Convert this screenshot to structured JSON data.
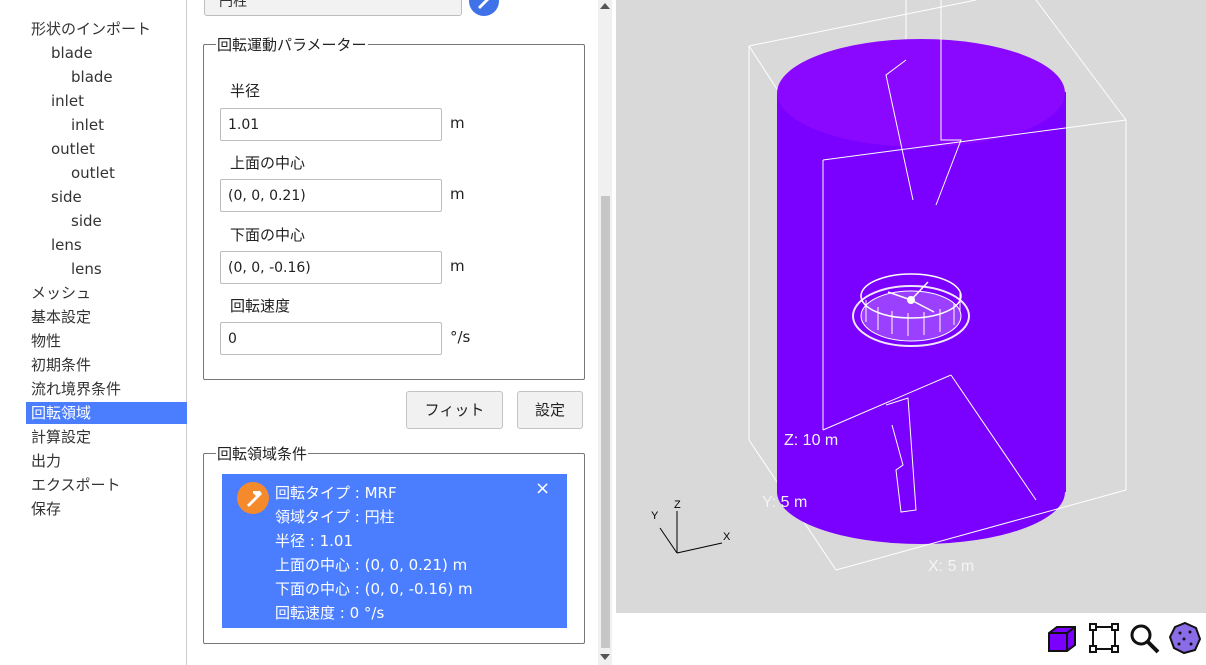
{
  "tree": [
    {
      "label": "形状のインポート",
      "level": 0
    },
    {
      "label": "blade",
      "level": 1
    },
    {
      "label": "blade",
      "level": 2
    },
    {
      "label": "inlet",
      "level": 1
    },
    {
      "label": "inlet",
      "level": 2
    },
    {
      "label": "outlet",
      "level": 1
    },
    {
      "label": "outlet",
      "level": 2
    },
    {
      "label": "side",
      "level": 1
    },
    {
      "label": "side",
      "level": 2
    },
    {
      "label": "lens",
      "level": 1
    },
    {
      "label": "lens",
      "level": 2
    },
    {
      "label": "メッシュ",
      "level": 0
    },
    {
      "label": "基本設定",
      "level": 0
    },
    {
      "label": "物性",
      "level": 0
    },
    {
      "label": "初期条件",
      "level": 0
    },
    {
      "label": "流れ境界条件",
      "level": 0
    },
    {
      "label": "回転領域",
      "level": 0,
      "selected": true
    },
    {
      "label": "計算設定",
      "level": 0
    },
    {
      "label": "出力",
      "level": 0
    },
    {
      "label": "エクスポート",
      "level": 0
    },
    {
      "label": "保存",
      "level": 0
    }
  ],
  "top": {
    "shape_select": "円柱"
  },
  "params": {
    "legend": "回転運動パラメーター",
    "radius": {
      "label": "半径",
      "value": "1.01",
      "unit": "m"
    },
    "top_center": {
      "label": "上面の中心",
      "value": "(0, 0, 0.21)",
      "unit": "m"
    },
    "bottom_center": {
      "label": "下面の中心",
      "value": "(0, 0, -0.16)",
      "unit": "m"
    },
    "speed": {
      "label": "回転速度",
      "value": "0",
      "unit": "°/s"
    }
  },
  "buttons": {
    "fit": "フィット",
    "set": "設定"
  },
  "conditions": {
    "legend": "回転領域条件",
    "close": "×",
    "lines": [
      "回転タイプ : MRF",
      "領域タイプ : 円柱",
      "半径 : 1.01",
      "上面の中心 : (0, 0, 0.21) m",
      "下面の中心 : (0, 0, -0.16) m",
      "回転速度 : 0 °/s"
    ]
  },
  "viewport": {
    "z_label": "Z: 10 m",
    "y_label": "Y: 5 m",
    "x_label": "X: 5 m",
    "axes": {
      "x": "X",
      "y": "Y",
      "z": "Z"
    },
    "cylinder_color": "#7a00ff",
    "background": "#d9d9d9"
  },
  "colors": {
    "accent": "#4a7eff",
    "warning_icon": "#f58a2c",
    "primary_icon": "#3f72e8"
  },
  "toolbar_icons": [
    "solid-view-icon",
    "bounding-box-icon",
    "zoom-icon",
    "points-view-icon"
  ]
}
